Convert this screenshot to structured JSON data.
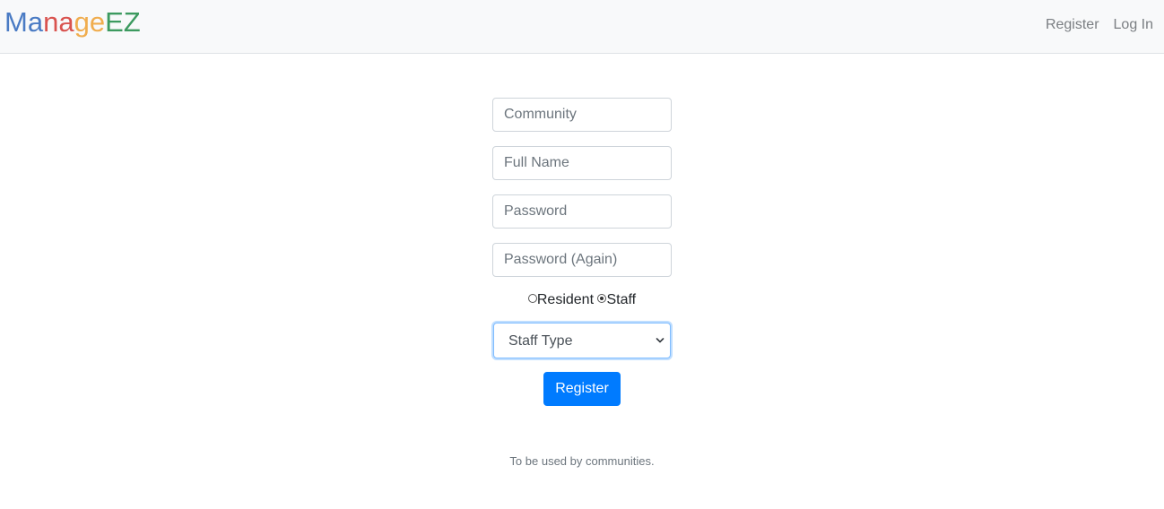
{
  "brand": {
    "letters": [
      {
        "char": "M",
        "color": "#4a7bc4"
      },
      {
        "char": "a",
        "color": "#4a7bc4"
      },
      {
        "char": "n",
        "color": "#d9534f"
      },
      {
        "char": "a",
        "color": "#d9534f"
      },
      {
        "char": "g",
        "color": "#f0ad4e"
      },
      {
        "char": "e",
        "color": "#f0ad4e"
      },
      {
        "char": "E",
        "color": "#3c9a5f"
      },
      {
        "char": "Z",
        "color": "#3c9a5f"
      }
    ]
  },
  "nav": {
    "register_label": "Register",
    "login_label": "Log In"
  },
  "form": {
    "community_placeholder": "Community",
    "fullname_placeholder": "Full Name",
    "password_placeholder": "Password",
    "password_again_placeholder": "Password (Again)",
    "role": {
      "resident_label": "Resident",
      "staff_label": "Staff",
      "selected": "Staff"
    },
    "staff_type_label": "Staff Type",
    "submit_label": "Register"
  },
  "footer": {
    "note": "To be used by communities."
  },
  "colors": {
    "primary": "#007bff",
    "navbar_bg": "#f8f9fa"
  }
}
